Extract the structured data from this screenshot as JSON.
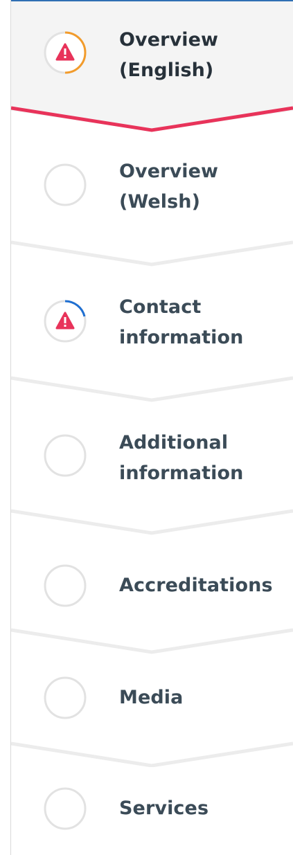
{
  "colors": {
    "active_bg": "#f4f4f4",
    "active_border": "#e8335a",
    "divider": "#ececec",
    "ring_empty": "#e2e2e2",
    "ring_partial_orange": "#f29b2b",
    "ring_partial_blue": "#1f6fd1",
    "warning": "#e8335a",
    "label": "#3b4b57"
  },
  "steps": [
    {
      "label_line1": "Overview",
      "label_line2": "(English)",
      "state": "active",
      "status": "warning",
      "icon": "warning-icon"
    },
    {
      "label_line1": "Overview",
      "label_line2": "(Welsh)",
      "state": "inactive",
      "status": "empty",
      "icon": "empty-circle-icon"
    },
    {
      "label_line1": "Contact",
      "label_line2": "information",
      "state": "inactive",
      "status": "warning",
      "icon": "warning-icon"
    },
    {
      "label_line1": "Additional",
      "label_line2": "information",
      "state": "inactive",
      "status": "empty",
      "icon": "empty-circle-icon"
    },
    {
      "label_line1": "Accreditations",
      "label_line2": "",
      "state": "inactive",
      "status": "empty",
      "icon": "empty-circle-icon"
    },
    {
      "label_line1": "Media",
      "label_line2": "",
      "state": "inactive",
      "status": "empty",
      "icon": "empty-circle-icon"
    },
    {
      "label_line1": "Services",
      "label_line2": "",
      "state": "inactive",
      "status": "empty",
      "icon": "empty-circle-icon"
    }
  ]
}
